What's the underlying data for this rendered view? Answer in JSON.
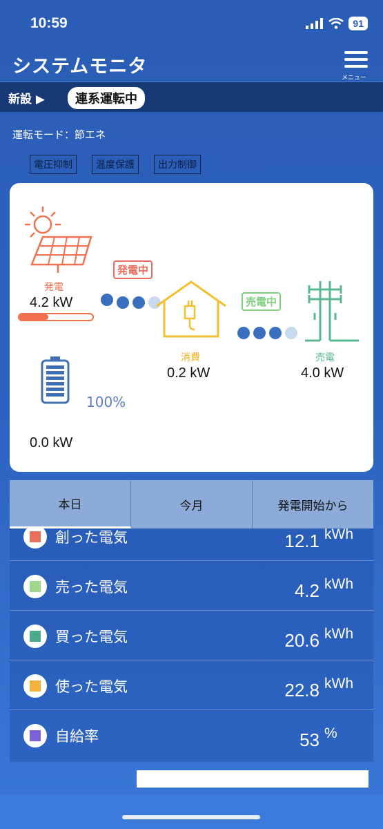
{
  "status_bar": {
    "time": "10:59",
    "battery": "91"
  },
  "header": {
    "title": "システムモニタ",
    "menu_label": "メニュー"
  },
  "strip": {
    "new_label": "新設 ▶",
    "badge": "連系運転中"
  },
  "mode": {
    "text": "運転モード：節エネ"
  },
  "flags": [
    "電圧抑制",
    "温度保護",
    "出力制御"
  ],
  "diagram": {
    "generation": {
      "label": "発電",
      "value": "4.2 kW",
      "level_fraction": 0.4
    },
    "gen_tag": "発電中",
    "consumption": {
      "label": "消費",
      "value": "0.2 kW"
    },
    "sell_tag": "売電中",
    "sell": {
      "label": "売電",
      "value": "4.0 kW"
    },
    "battery": {
      "percent": "100%",
      "value": "0.0 kW"
    }
  },
  "tabs": [
    "本日",
    "今月",
    "発電開始から"
  ],
  "stats": [
    {
      "name": "創った電気",
      "value": "12.1",
      "unit": "kWh",
      "color": "#e8715c"
    },
    {
      "name": "売った電気",
      "value": "4.2",
      "unit": "kWh",
      "color": "#9fd88c"
    },
    {
      "name": "買った電気",
      "value": "20.6",
      "unit": "kWh",
      "color": "#4caa8c"
    },
    {
      "name": "使った電気",
      "value": "22.8",
      "unit": "kWh",
      "color": "#f3b23a"
    },
    {
      "name": "自給率",
      "value": "53",
      "unit": "%",
      "color": "#7b62d8"
    }
  ],
  "colors": {
    "solar": "#f07050",
    "house": "#f0c030",
    "grid": "#5ab890",
    "battery": "#3f6fb5",
    "flow_dot": "#3a6fc0",
    "flow_dot_light": "#c9d9ee"
  }
}
